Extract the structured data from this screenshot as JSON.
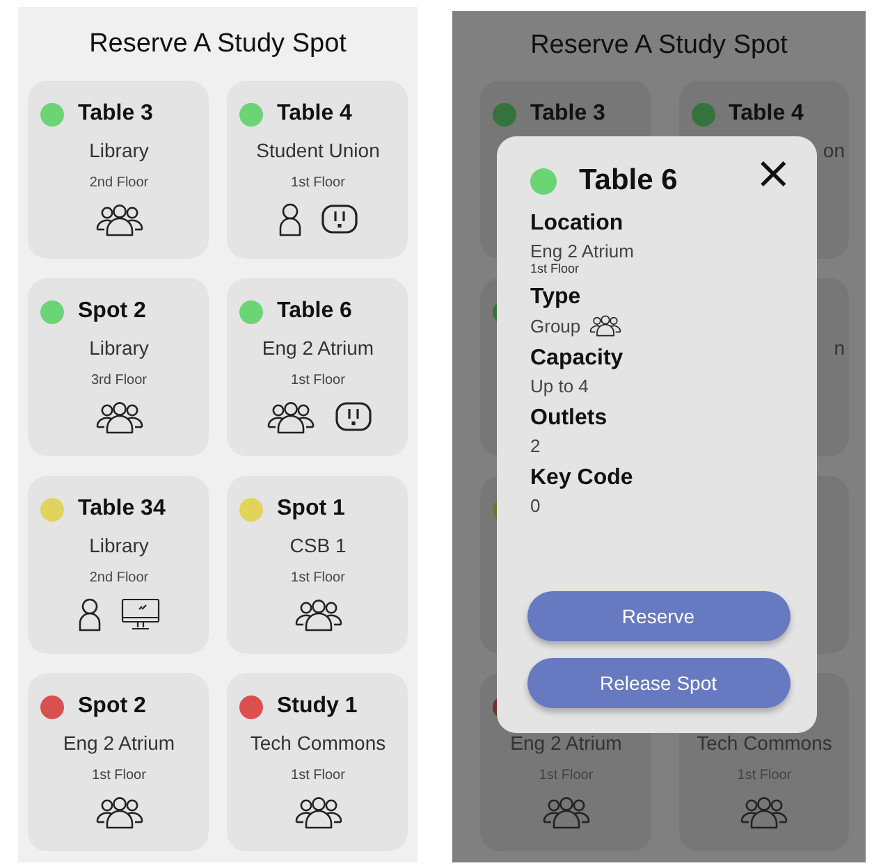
{
  "left_screen": {
    "title": "Reserve A Study Spot",
    "cards": [
      {
        "color": "#6bd475",
        "title": "Table 3",
        "location": "Library",
        "floor": "2nd Floor",
        "amenities": [
          {
            "kind": "group"
          }
        ]
      },
      {
        "color": "#6bd475",
        "title": "Table 4",
        "location": "Student Union",
        "floor": "1st Floor",
        "amenities": [
          {
            "kind": "single"
          },
          {
            "kind": "outlet"
          }
        ]
      },
      {
        "color": "#6bd475",
        "title": "Spot 2",
        "location": "Library",
        "floor": "3rd Floor",
        "amenities": [
          {
            "kind": "group"
          }
        ]
      },
      {
        "color": "#6bd475",
        "title": "Table 6",
        "location": "Eng 2 Atrium",
        "floor": "1st Floor",
        "amenities": [
          {
            "kind": "group"
          },
          {
            "kind": "outlet"
          }
        ]
      },
      {
        "color": "#e2d35c",
        "title": "Table 34",
        "location": "Library",
        "floor": "2nd Floor",
        "amenities": [
          {
            "kind": "single"
          },
          {
            "kind": "computer"
          }
        ]
      },
      {
        "color": "#e2d35c",
        "title": "Spot 1",
        "location": "CSB 1",
        "floor": "1st Floor",
        "amenities": [
          {
            "kind": "group"
          }
        ]
      },
      {
        "color": "#d9504f",
        "title": "Spot 2",
        "location": "Eng 2 Atrium",
        "floor": "1st Floor",
        "amenities": [
          {
            "kind": "group"
          }
        ]
      },
      {
        "color": "#d9504f",
        "title": "Study 1",
        "location": "Tech Commons",
        "floor": "1st Floor",
        "amenities": [
          {
            "kind": "group"
          }
        ]
      }
    ]
  },
  "right_screen": {
    "title": "Reserve A Study Spot",
    "cards": [
      {
        "kind": "spot",
        "color": "#35733d",
        "title": "Table 3"
      },
      {
        "kind": "spot",
        "color": "#35733d",
        "title": "Table 4",
        "location": "on",
        "location_cut": true
      },
      {
        "kind": "spot",
        "color": "#35733d"
      },
      {
        "kind": "spot",
        "location": "n",
        "location_cut": true
      },
      {
        "kind": "spot",
        "color": "#76702e"
      },
      {
        "kind": "covered"
      },
      {
        "kind": "spot",
        "color": "#74302f",
        "location": "Eng 2 Atrium",
        "location_cut": false,
        "floor": "1st Floor",
        "amenities": [
          {
            "kind": "group"
          }
        ]
      },
      {
        "kind": "spot",
        "location": "Tech Commons",
        "location_cut": false,
        "floor": "1st Floor",
        "amenities": [
          {
            "kind": "group"
          }
        ]
      }
    ],
    "dialog": {
      "color": "#6bd475",
      "title": "Table 6",
      "close": "×",
      "fields": [
        {
          "label": "Location",
          "value": "Eng 2 Atrium",
          "sub": "1st Floor"
        },
        {
          "label": "Type",
          "value": "Group",
          "amenities": [
            {
              "kind": "group"
            }
          ]
        },
        {
          "label": "Capacity",
          "value": "Up to 4"
        },
        {
          "label": "Outlets",
          "value": "2"
        },
        {
          "label": "Key Code",
          "value": "0"
        }
      ],
      "buttons": [
        "Reserve",
        "Release Spot"
      ]
    }
  }
}
